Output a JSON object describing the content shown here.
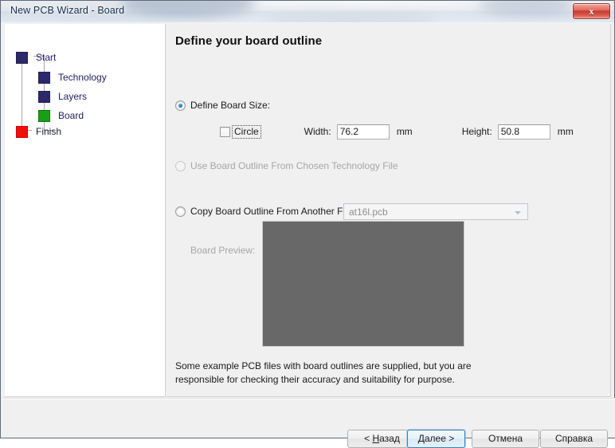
{
  "window": {
    "title": "New PCB Wizard - Board",
    "close_label": "x"
  },
  "sidebar": {
    "items": [
      {
        "label": "Start",
        "color": "#2c2a6b",
        "state": "done"
      },
      {
        "label": "Technology",
        "color": "#2c2a6b",
        "state": "done"
      },
      {
        "label": "Layers",
        "color": "#2c2a6b",
        "state": "done"
      },
      {
        "label": "Board",
        "color": "#16a016",
        "state": "current"
      },
      {
        "label": "Finish",
        "color": "#f40c0c",
        "state": "pending"
      }
    ]
  },
  "content": {
    "heading": "Define your board outline",
    "options": [
      {
        "label": "Define Board Size:",
        "selected": true,
        "disabled": false
      },
      {
        "label": "Use Board Outline From Chosen Technology File",
        "selected": false,
        "disabled": true
      },
      {
        "label": "Copy Board Outline From Another File:",
        "selected": false,
        "disabled": false
      }
    ],
    "size": {
      "circle_label": "Circle",
      "circle_checked": false,
      "width_label": "Width:",
      "width_value": "76.2",
      "width_unit": "mm",
      "height_label": "Height:",
      "height_value": "50.8",
      "height_unit": "mm"
    },
    "file_combo": {
      "value": "at16l.pcb",
      "disabled": true
    },
    "preview": {
      "label": "Board Preview:",
      "fill_color": "#686868"
    },
    "note": "Some example PCB files with board outlines are supplied, but you are responsible for checking their accuracy and suitability for purpose."
  },
  "footer": {
    "back": {
      "pre": "< ",
      "accel": "Н",
      "post": "азад"
    },
    "next": {
      "pre": "",
      "accel": "Д",
      "post": "алее >"
    },
    "cancel_label": "Отмена",
    "help_label": "Справка"
  }
}
